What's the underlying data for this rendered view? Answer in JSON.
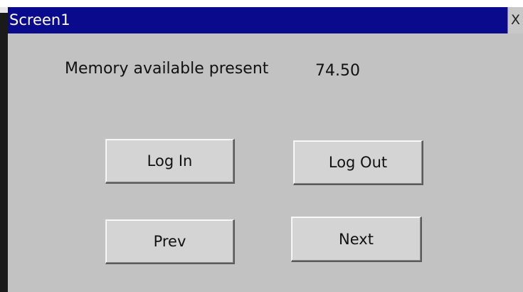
{
  "window": {
    "title": "Screen1",
    "close_label": "X"
  },
  "memory": {
    "label": "Memory available present",
    "value": "74.50"
  },
  "buttons": {
    "log_in": "Log In",
    "log_out": "Log Out",
    "prev": "Prev",
    "next": "Next"
  },
  "colors": {
    "title_bar": "#0a0a8c",
    "window_bg": "#c2c2c2",
    "button_bg": "#d4d4d4"
  }
}
